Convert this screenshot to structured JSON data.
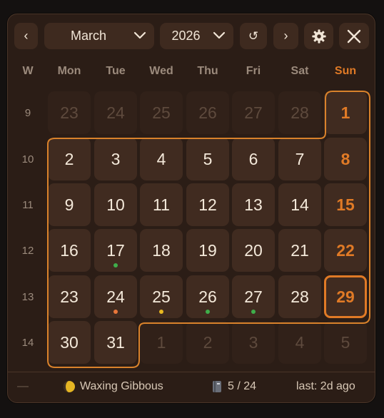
{
  "header": {
    "prev_label": "‹",
    "month": "March",
    "year": "2026",
    "reset_label": "↺",
    "next_label": "›"
  },
  "weekday_headers": [
    "W",
    "Mon",
    "Tue",
    "Wed",
    "Thu",
    "Fri",
    "Sat",
    "Sun"
  ],
  "weeks": [
    {
      "num": "9",
      "days": [
        "23",
        "24",
        "25",
        "26",
        "27",
        "28",
        "1"
      ]
    },
    {
      "num": "10",
      "days": [
        "2",
        "3",
        "4",
        "5",
        "6",
        "7",
        "8"
      ]
    },
    {
      "num": "11",
      "days": [
        "9",
        "10",
        "11",
        "12",
        "13",
        "14",
        "15"
      ]
    },
    {
      "num": "12",
      "days": [
        "16",
        "17",
        "18",
        "19",
        "20",
        "21",
        "22"
      ]
    },
    {
      "num": "13",
      "days": [
        "23",
        "24",
        "25",
        "26",
        "27",
        "28",
        "29"
      ]
    },
    {
      "num": "14",
      "days": [
        "30",
        "31",
        "1",
        "2",
        "3",
        "4",
        "5"
      ]
    }
  ],
  "today": "29",
  "event_dots": {
    "17": "#3fae4a",
    "24": "#e8763a",
    "25": "#e8b820",
    "26": "#3fae4a",
    "27": "#3fae4a"
  },
  "footer": {
    "left": "—",
    "moon_phase": "Waxing Gibbous",
    "progress": "5 / 24",
    "last": "last: 2d ago"
  },
  "colors": {
    "accent": "#e07a26",
    "panel": "#2b1d16",
    "cell": "#402b20",
    "cell_muted": "#312119"
  }
}
